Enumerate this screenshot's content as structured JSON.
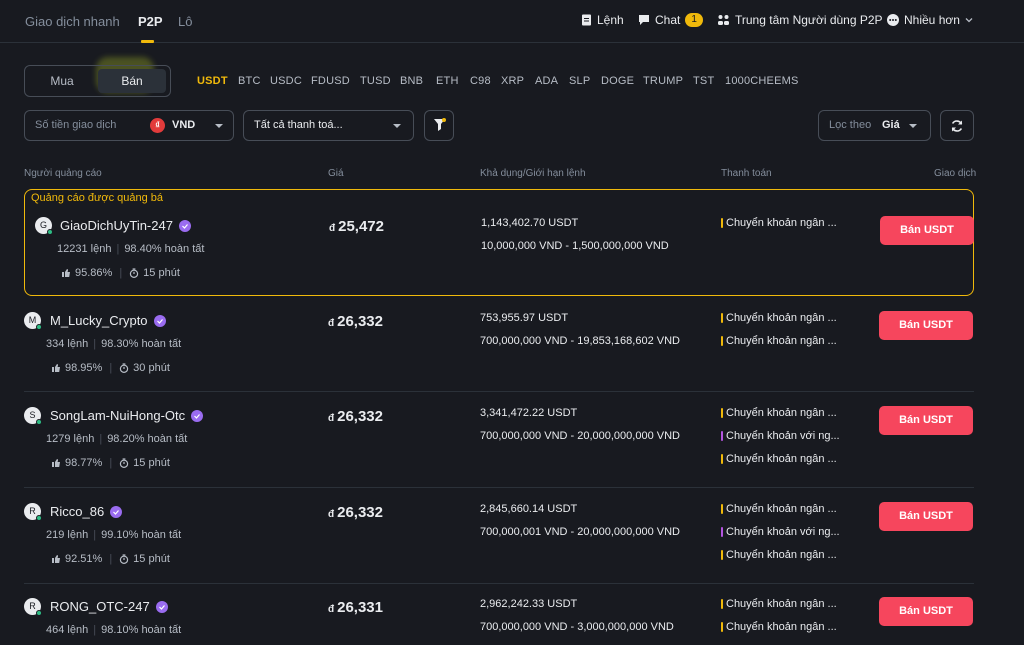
{
  "nav": {
    "tabs": [
      "Giao dịch nhanh",
      "P2P",
      "Lô"
    ],
    "items": {
      "orders": "Lệnh",
      "chat": "Chat",
      "chat_badge": "1",
      "user_center": "Trung tâm Người dùng P2P",
      "more": "Nhiều hơn"
    }
  },
  "trade_switch": {
    "buy": "Mua",
    "sell": "Bán",
    "selected": "Bán"
  },
  "assets": [
    "USDT",
    "BTC",
    "USDC",
    "FDUSD",
    "TUSD",
    "BNB",
    "ETH",
    "C98",
    "XRP",
    "ADA",
    "SLP",
    "DOGE",
    "TRUMP",
    "TST",
    "1000CHEEMS"
  ],
  "selected_asset": "USDT",
  "filters": {
    "amount_placeholder": "Số tiền giao dịch",
    "currency": "VND",
    "currency_symbol": "₫",
    "payment": "Tất cả thanh toá...",
    "sort_label": "Lọc theo",
    "sort_value": "Giá"
  },
  "columns": [
    "Người quảng cáo",
    "Giá",
    "Khả dụng/Giới hạn lệnh",
    "Thanh toán",
    "Giao dịch"
  ],
  "promo_label": "Quảng cáo được quảng bá",
  "ads": [
    {
      "avatar": "G",
      "name": "GiaoDichUyTin-247",
      "orders": "12231 lệnh",
      "completion": "98.40% hoàn tất",
      "rating": "95.86%",
      "time": "15 phút",
      "currency": "đ",
      "price": "25,472",
      "available": "1,143,402.70 USDT",
      "limit": "10,000,000 VND - 1,500,000,000 VND",
      "payments": [
        {
          "label": "Chuyển khoản ngân ...",
          "color": "#f0b90b"
        }
      ],
      "action": "Bán USDT"
    },
    {
      "avatar": "M",
      "name": "M_Lucky_Crypto",
      "orders": "334 lệnh",
      "completion": "98.30% hoàn tất",
      "rating": "98.95%",
      "time": "30 phút",
      "currency": "đ",
      "price": "26,332",
      "available": "753,955.97 USDT",
      "limit": "700,000,000 VND - 19,853,168,602 VND",
      "payments": [
        {
          "label": "Chuyển khoản ngân ...",
          "color": "#f0b90b"
        },
        {
          "label": "Chuyển khoản ngân ...",
          "color": "#f0b90b"
        }
      ],
      "action": "Bán USDT"
    },
    {
      "avatar": "S",
      "name": "SongLam-NuiHong-Otc",
      "orders": "1279 lệnh",
      "completion": "98.20% hoàn tất",
      "rating": "98.77%",
      "time": "15 phút",
      "currency": "đ",
      "price": "26,332",
      "available": "3,341,472.22 USDT",
      "limit": "700,000,000 VND - 20,000,000,000 VND",
      "payments": [
        {
          "label": "Chuyển khoản ngân ...",
          "color": "#f0b90b"
        },
        {
          "label": "Chuyển khoản với ng...",
          "color": "#b455e0"
        },
        {
          "label": "Chuyển khoản ngân ...",
          "color": "#f0b90b"
        }
      ],
      "action": "Bán USDT"
    },
    {
      "avatar": "R",
      "name": "Ricco_86",
      "orders": "219 lệnh",
      "completion": "99.10% hoàn tất",
      "rating": "92.51%",
      "time": "15 phút",
      "currency": "đ",
      "price": "26,332",
      "available": "2,845,660.14 USDT",
      "limit": "700,000,001 VND - 20,000,000,000 VND",
      "payments": [
        {
          "label": "Chuyển khoản ngân ...",
          "color": "#f0b90b"
        },
        {
          "label": "Chuyển khoản với ng...",
          "color": "#b455e0"
        },
        {
          "label": "Chuyển khoản ngân ...",
          "color": "#f0b90b"
        }
      ],
      "action": "Bán USDT"
    },
    {
      "avatar": "R",
      "name": "RONG_OTC-247",
      "orders": "464 lệnh",
      "completion": "98.10% hoàn tất",
      "rating": "",
      "time": "",
      "currency": "đ",
      "price": "26,331",
      "available": "2,962,242.33 USDT",
      "limit": "700,000,000 VND - 3,000,000,000 VND",
      "payments": [
        {
          "label": "Chuyển khoản ngân ...",
          "color": "#f0b90b"
        },
        {
          "label": "Chuyển khoản ngân ...",
          "color": "#f0b90b"
        }
      ],
      "action": "Bán USDT"
    }
  ]
}
